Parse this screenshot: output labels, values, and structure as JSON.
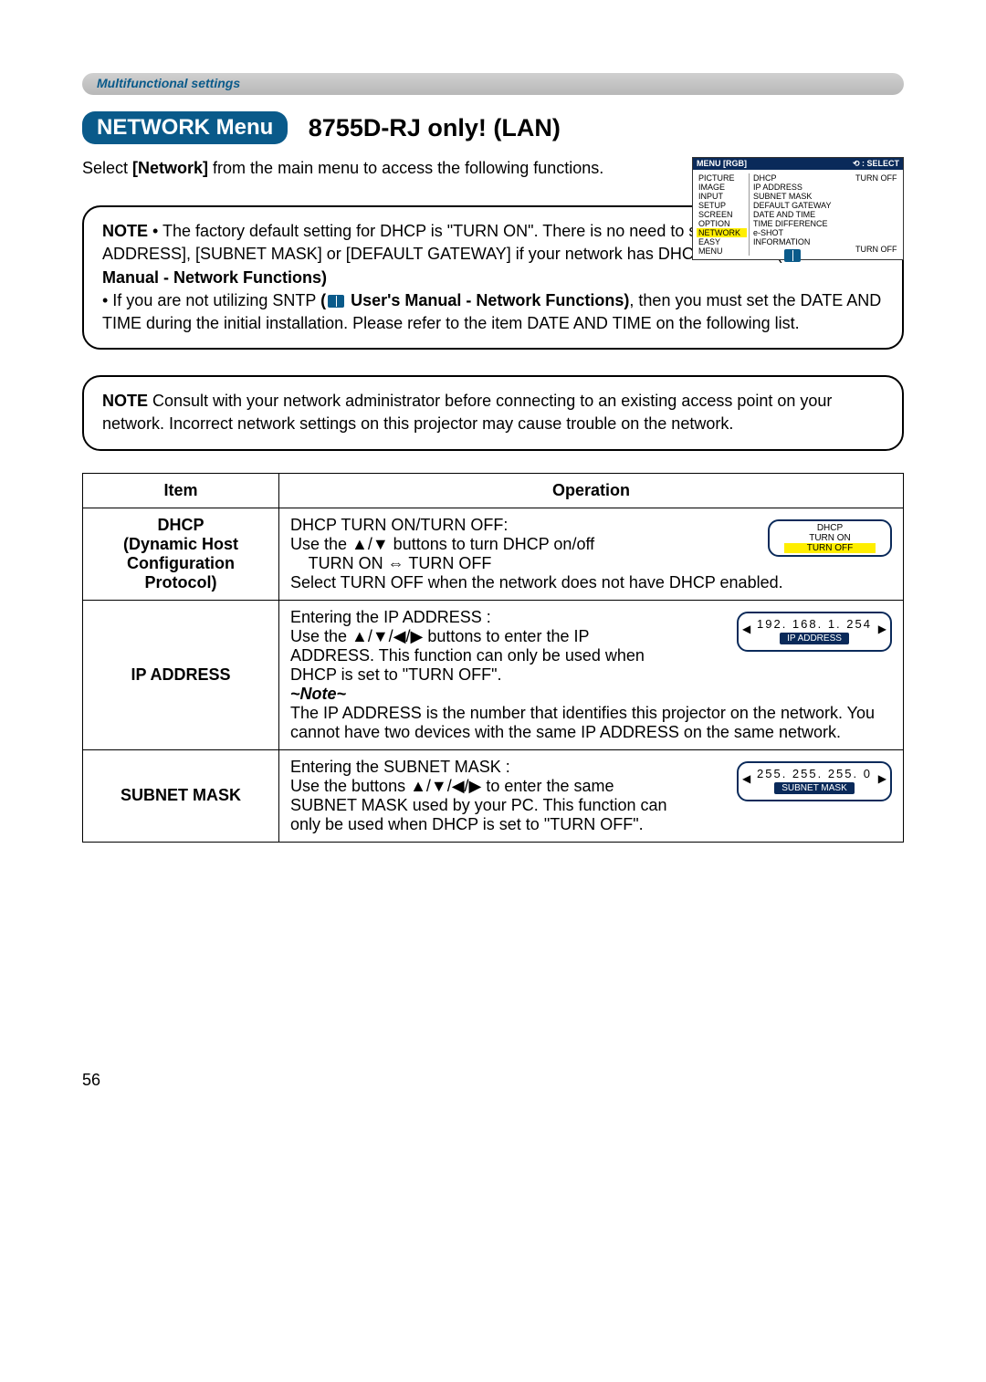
{
  "header_bar": "Multifunctional settings",
  "title_pill": "NETWORK Menu",
  "title_suffix": "8755D-RJ only! (LAN)",
  "intro": {
    "pre": "Select ",
    "bold": "[Network]",
    "post": " from the main menu to access the following functions."
  },
  "menu_screenshot": {
    "header_left": "MENU  [RGB]",
    "header_right": "⟲ : SELECT",
    "left_items": [
      "PICTURE",
      "IMAGE",
      "INPUT",
      "SETUP",
      "SCREEN",
      "OPTION",
      "NETWORK",
      "EASY MENU"
    ],
    "left_highlight_index": 6,
    "mid_items": [
      "DHCP",
      "IP ADDRESS",
      "SUBNET MASK",
      "DEFAULT GATEWAY",
      "DATE AND TIME",
      "TIME DIFFERENCE",
      "e-SHOT",
      "INFORMATION"
    ],
    "mid_highlight_under": "TURN OFF",
    "right_value": "TURN OFF"
  },
  "note1": {
    "label": "NOTE",
    "line1_a": " • The factory default setting for DHCP is \"TURN ON\". There is no need to set up [DHCP], [IP ADDRESS], [SUBNET MASK] or [DEFAULT GATEWAY] if your network has DHCP enabled. (",
    "line1_link": " User's Manual - Network Functions)",
    "line2_a": "• If you are not utilizing SNTP ",
    "line2_link": "( User's Manual - Network Functions)",
    "line2_b": ", then you must set the DATE AND TIME during the initial installation. Please refer to the item DATE AND TIME on the following list."
  },
  "note2": {
    "label": "NOTE",
    "body": "  Consult with your network administrator before connecting to an existing access point on your network. Incorrect network settings on this projector may cause trouble on the network."
  },
  "table": {
    "col1": "Item",
    "col2": "Operation",
    "rows": [
      {
        "item_line1": "DHCP",
        "item_line2": "(Dynamic Host Configuration Protocol)",
        "op": {
          "l1": "DHCP TURN ON/TURN OFF:",
          "l2_a": "Use the ▲/▼ buttons to turn DHCP on/off",
          "l3": "    TURN ON ⇔ TURN OFF",
          "l4": "Select TURN OFF when the network does not have  DHCP enabled."
        },
        "osd": {
          "title": "DHCP",
          "opt1": "TURN ON",
          "opt2": "TURN OFF"
        }
      },
      {
        "item_line1": "IP ADDRESS",
        "op": {
          "l1": "Entering the IP ADDRESS :",
          "l2": "Use the ▲/▼/◀/▶ buttons to enter the IP ADDRESS. This function can only be used when DHCP is set to \"TURN OFF\".",
          "note_tag": "~Note~",
          "l3": "The IP ADDRESS is the number that identifies this projector on the network. You cannot have two devices with the same IP ADDRESS on the same network."
        },
        "osd": {
          "nums": "192. 168.  1.  254",
          "label": "IP ADDRESS"
        }
      },
      {
        "item_line1": "SUBNET MASK",
        "op": {
          "l1": "Entering the SUBNET MASK :",
          "l2": "Use the buttons ▲/▼/◀/▶ to enter the same SUBNET MASK used by your PC. This function can only be used when DHCP is set to \"TURN OFF\"."
        },
        "osd": {
          "nums": "255. 255. 255.  0",
          "label": "SUBNET MASK"
        }
      }
    ]
  },
  "page_number": "56"
}
